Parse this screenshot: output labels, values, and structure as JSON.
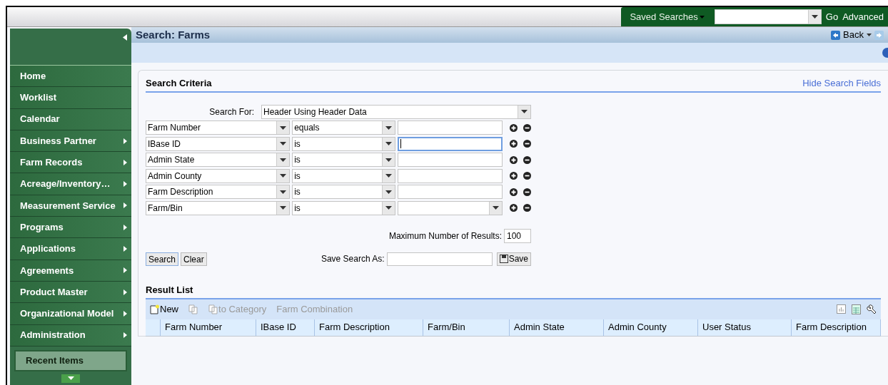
{
  "top_bar": {
    "saved_searches": "Saved Searches",
    "go": "Go",
    "advanced": "Advanced"
  },
  "sidebar": {
    "items": [
      {
        "label": "Home",
        "submenu": false
      },
      {
        "label": "Worklist",
        "submenu": false
      },
      {
        "label": "Calendar",
        "submenu": false
      },
      {
        "label": "Business Partner",
        "submenu": true
      },
      {
        "label": "Farm Records",
        "submenu": true
      },
      {
        "label": "Acreage/Inventory…",
        "submenu": true
      },
      {
        "label": "Measurement Service",
        "submenu": true
      },
      {
        "label": "Programs",
        "submenu": true
      },
      {
        "label": "Applications",
        "submenu": true
      },
      {
        "label": "Agreements",
        "submenu": true
      },
      {
        "label": "Product Master",
        "submenu": true
      },
      {
        "label": "Organizational Model",
        "submenu": true
      },
      {
        "label": "Administration",
        "submenu": true
      }
    ],
    "recent_items": "Recent Items"
  },
  "page": {
    "title": "Search: Farms",
    "back": "Back"
  },
  "search_criteria": {
    "title": "Search Criteria",
    "hide_link": "Hide Search Fields",
    "search_for_label": "Search For:",
    "search_for_value": "Header Using Header Data",
    "rows": [
      {
        "field": "Farm Number",
        "operator": "equals",
        "kind": "text",
        "focused": false
      },
      {
        "field": "IBase ID",
        "operator": "is",
        "kind": "text",
        "focused": true
      },
      {
        "field": "Admin State",
        "operator": "is",
        "kind": "text",
        "focused": false
      },
      {
        "field": "Admin County",
        "operator": "is",
        "kind": "text",
        "focused": false
      },
      {
        "field": "Farm Description",
        "operator": "is",
        "kind": "text",
        "focused": false
      },
      {
        "field": "Farm/Bin",
        "operator": "is",
        "kind": "dropdown",
        "focused": false
      }
    ],
    "max_results_label": "Maximum Number of Results:",
    "max_results": "100",
    "search_button": "Search",
    "clear_button": "Clear",
    "save_as_label": "Save Search As:",
    "save_button": "Save"
  },
  "result_list": {
    "title": "Result List",
    "toolbar": [
      {
        "label": "New",
        "kind": "new",
        "disabled": false
      },
      {
        "kind": "copy",
        "disabled": true
      },
      {
        "label": "to Category",
        "kind": "copy",
        "disabled": true
      },
      {
        "label": "Farm Combination",
        "kind": "plain",
        "disabled": true
      }
    ],
    "columns": [
      "Farm Number",
      "IBase ID",
      "Farm Description",
      "Farm/Bin",
      "Admin State",
      "Admin County",
      "User Status",
      "Farm Description"
    ]
  }
}
